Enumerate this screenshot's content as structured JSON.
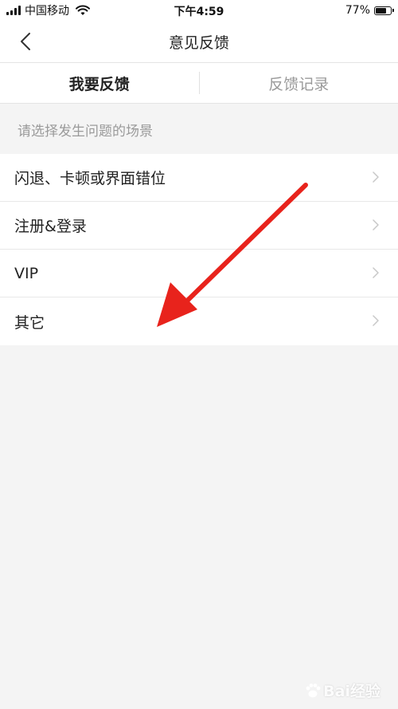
{
  "status_bar": {
    "carrier": "中国移动",
    "time": "下午4:59",
    "battery_percent_text": "77%",
    "battery_level": 0.77
  },
  "nav": {
    "title": "意见反馈",
    "back_icon": "chevron-left-icon"
  },
  "tabs": [
    {
      "label": "我要反馈",
      "active": true
    },
    {
      "label": "反馈记录",
      "active": false
    }
  ],
  "section": {
    "title": "请选择发生问题的场景"
  },
  "scenarios": [
    {
      "label": "闪退、卡顿或界面错位"
    },
    {
      "label": "注册&登录"
    },
    {
      "label": "VIP"
    },
    {
      "label": "其它"
    }
  ],
  "watermark": {
    "text": "Bai经验"
  },
  "colors": {
    "background": "#f4f4f4",
    "panel": "#ffffff",
    "annotation_arrow": "#e8231c",
    "muted_text": "#9a9a9a",
    "primary_text": "#222222"
  }
}
